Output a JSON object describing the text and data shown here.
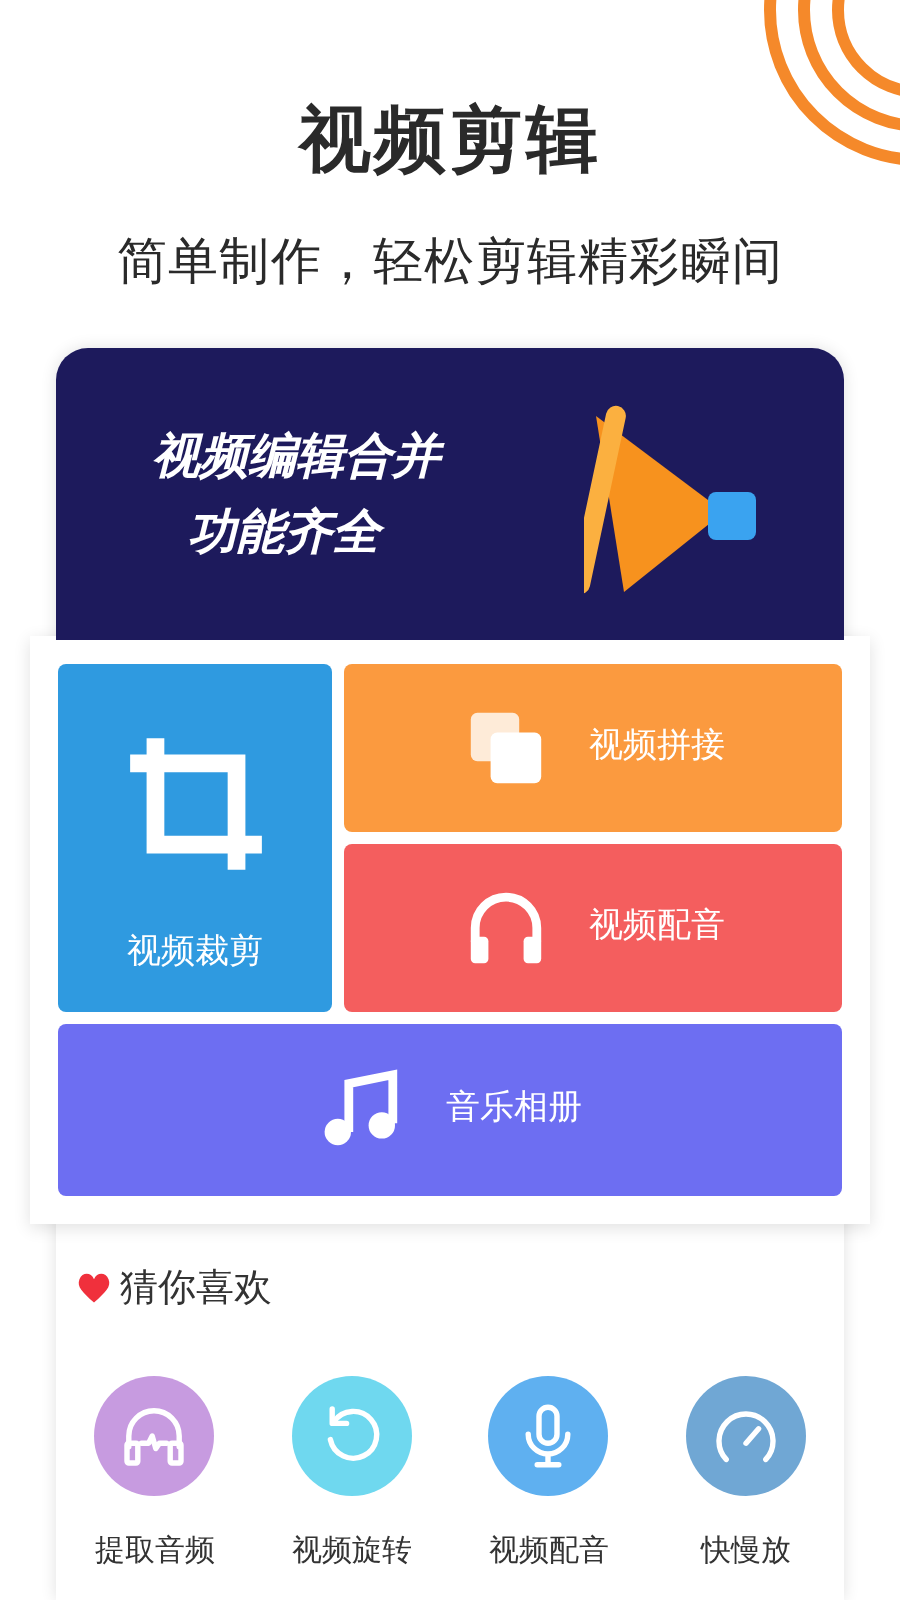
{
  "headline": "视频剪辑",
  "tagline": "简单制作，轻松剪辑精彩瞬间",
  "banner": {
    "lines": [
      "视频编辑合并",
      "功能齐全"
    ]
  },
  "tools": [
    {
      "kind": "crop",
      "label": "视频裁剪",
      "color": "#2f9ae0"
    },
    {
      "kind": "merge",
      "label": "视频拼接",
      "color": "#fb9a3f"
    },
    {
      "kind": "dub",
      "label": "视频配音",
      "color": "#f45e5e"
    },
    {
      "kind": "album",
      "label": "音乐相册",
      "color": "#6d6ef2"
    }
  ],
  "recommend": {
    "title": "猜你喜欢",
    "items": [
      {
        "kind": "audio",
        "label": "提取音频",
        "color": "#c79be0"
      },
      {
        "kind": "rotate",
        "label": "视频旋转",
        "color": "#6fd8ef"
      },
      {
        "kind": "mic",
        "label": "视频配音",
        "color": "#5fb0f0"
      },
      {
        "kind": "speed",
        "label": "快慢放",
        "color": "#70a7d4"
      }
    ]
  }
}
